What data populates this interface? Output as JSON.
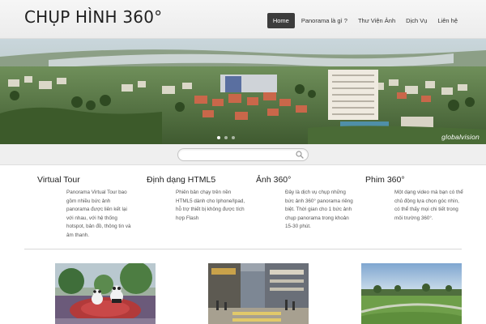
{
  "site": {
    "title": "CHỤP HÌNH 360°"
  },
  "nav": {
    "items": [
      {
        "label": "Home",
        "active": true
      },
      {
        "label": "Panorama là gì ?",
        "active": false
      },
      {
        "label": "Thư Viện Ảnh",
        "active": false
      },
      {
        "label": "Dịch Vụ",
        "active": false
      },
      {
        "label": "Liên hệ",
        "active": false
      }
    ]
  },
  "banner": {
    "watermark": "globalvision",
    "slide_count": 3,
    "active_slide": 1
  },
  "search": {
    "placeholder": "",
    "value": "",
    "icon": "search-icon"
  },
  "features": [
    {
      "title": "Virtual Tour",
      "text": "Panorama Virtual Tour bao gồm nhiều bức ảnh panorama được liên kết lại với nhau, với hệ thống hotspot, bản đồ, thông tin và âm thanh."
    },
    {
      "title": "Định dạng HTML5",
      "text": "Phiên bản chạy trên nền HTML5 dành cho Iphone/Ipad, hỗ trợ thiết bị không được tích hợp Flash"
    },
    {
      "title": "Ảnh 360°",
      "text": "Đây là dịch vụ chụp những bức ảnh 360° panorama riêng biệt. Thời gian cho 1 bức ảnh chụp panorama trong khoản 15-30 phút."
    },
    {
      "title": "Phim 360°",
      "text": "Một dạng video mà bạn có thể chủ động lựa chọn góc nhìn, có thể thấy mọi chi tiết trong môi trường 360°."
    }
  ],
  "thumbnails": [
    {
      "name": "garden-pandas-thumbnail"
    },
    {
      "name": "city-street-thumbnail"
    },
    {
      "name": "park-lawn-thumbnail"
    }
  ],
  "colors": {
    "nav_active_bg": "#3c3c3c",
    "header_bg": "#f0f0f0",
    "search_strip_bg": "#efefef"
  }
}
